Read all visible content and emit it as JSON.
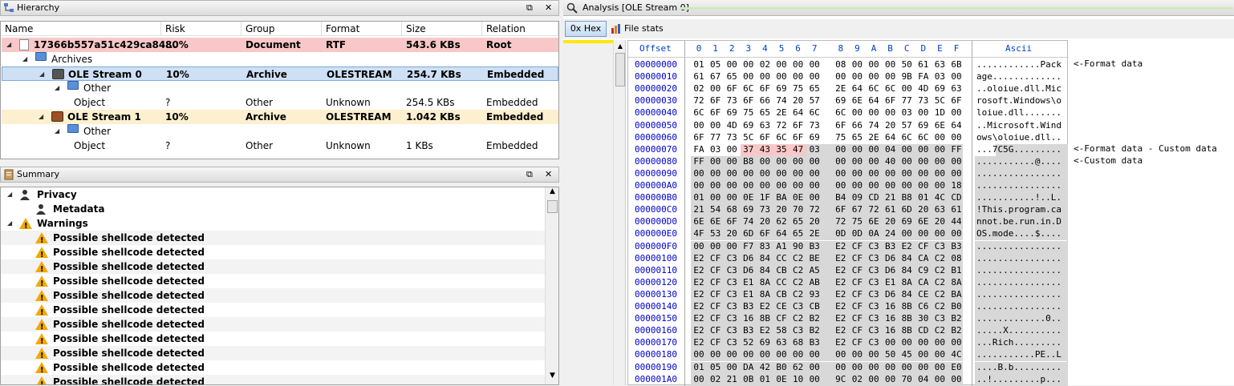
{
  "hierarchy": {
    "title": "Hierarchy",
    "columns": [
      "Name",
      "Risk",
      "Group",
      "Format",
      "Size",
      "Relation"
    ],
    "rows": [
      {
        "name": "17366b557a51c429ca84...",
        "risk": "80%",
        "group": "Document",
        "format": "RTF",
        "size": "543.6 KBs",
        "relation": "Root"
      },
      {
        "name": "Archives"
      },
      {
        "name": "OLE Stream 0",
        "risk": "10%",
        "group": "Archive",
        "format": "OLESTREAM",
        "size": "254.7 KBs",
        "relation": "Embedded"
      },
      {
        "name": "Other"
      },
      {
        "name": "Object",
        "risk": "?",
        "group": "Other",
        "format": "Unknown",
        "size": "254.5 KBs",
        "relation": "Embedded"
      },
      {
        "name": "OLE Stream 1",
        "risk": "10%",
        "group": "Archive",
        "format": "OLESTREAM",
        "size": "1.042 KBs",
        "relation": "Embedded"
      },
      {
        "name": "Other"
      },
      {
        "name": "Object",
        "risk": "?",
        "group": "Other",
        "format": "Unknown",
        "size": "1 KBs",
        "relation": "Embedded"
      }
    ]
  },
  "summary": {
    "title": "Summary",
    "privacy": "Privacy",
    "metadata": "Metadata",
    "warnings": "Warnings",
    "items": [
      "Possible shellcode detected",
      "Possible shellcode detected",
      "Possible shellcode detected",
      "Possible shellcode detected",
      "Possible shellcode detected",
      "Possible shellcode detected",
      "Possible shellcode detected",
      "Possible shellcode detected",
      "Possible shellcode detected",
      "Possible shellcode detected",
      "Possible shellcode detected"
    ]
  },
  "analysis": {
    "title": "Analysis [OLE Stream 0]",
    "hex_button": "0x Hex",
    "stats_button": "File stats",
    "offset_header": "Offset",
    "ascii_header": "Ascii",
    "byte_headers": [
      "0",
      "1",
      "2",
      "3",
      "4",
      "5",
      "6",
      "7",
      "8",
      "9",
      "A",
      "B",
      "C",
      "D",
      "E",
      "F"
    ],
    "rows": [
      {
        "off": "00000000",
        "bytes": "01 05 00 00 02 00 00 00 08 00 00 00 50 61 63 6B",
        "ascii": "............Pack",
        "note": "<-Format data"
      },
      {
        "off": "00000010",
        "bytes": "61 67 65 00 00 00 00 00 00 00 00 00 9B FA 03 00",
        "ascii": "age.............",
        "note": ""
      },
      {
        "off": "00000020",
        "bytes": "02 00 6F 6C 6F 69 75 65 2E 64 6C 6C 00 4D 69 63",
        "ascii": "..oloiue.dll.Mic",
        "note": ""
      },
      {
        "off": "00000030",
        "bytes": "72 6F 73 6F 66 74 20 57 69 6E 64 6F 77 73 5C 6F",
        "ascii": "rosoft.Windows\\o",
        "note": ""
      },
      {
        "off": "00000040",
        "bytes": "6C 6F 69 75 65 2E 64 6C 6C 00 00 00 03 00 1D 00",
        "ascii": "loiue.dll.......",
        "note": ""
      },
      {
        "off": "00000050",
        "bytes": "00 00 4D 69 63 72 6F 73 6F 66 74 20 57 69 6E 64",
        "ascii": "..Microsoft.Wind",
        "note": ""
      },
      {
        "off": "00000060",
        "bytes": "6F 77 73 5C 6F 6C 6F 69 75 65 2E 64 6C 6C 00 00",
        "ascii": "ows\\oloiue.dll..",
        "note": ""
      },
      {
        "off": "00000070",
        "bytes": "FA 03 00 37 43 35 47 03 00 00 00 04 00 00 00 FF",
        "ascii": "...7C5G.........",
        "note": "<-Format data - Custom data"
      },
      {
        "off": "00000080",
        "bytes": "FF 00 00 B8 00 00 00 00 00 00 00 40 00 00 00 00",
        "ascii": "...........@....",
        "note": "<-Custom data"
      },
      {
        "off": "00000090",
        "bytes": "00 00 00 00 00 00 00 00 00 00 00 00 00 00 00 00",
        "ascii": "................",
        "note": ""
      },
      {
        "off": "000000A0",
        "bytes": "00 00 00 00 00 00 00 00 00 00 00 00 00 00 00 18",
        "ascii": "................",
        "note": ""
      },
      {
        "off": "000000B0",
        "bytes": "01 00 00 0E 1F BA 0E 00 B4 09 CD 21 B8 01 4C CD",
        "ascii": "...........!..L.",
        "note": ""
      },
      {
        "off": "000000C0",
        "bytes": "21 54 68 69 73 20 70 72 6F 67 72 61 6D 20 63 61",
        "ascii": "!This.program.ca",
        "note": ""
      },
      {
        "off": "000000D0",
        "bytes": "6E 6E 6F 74 20 62 65 20 72 75 6E 20 69 6E 20 44",
        "ascii": "nnot.be.run.in.D",
        "note": ""
      },
      {
        "off": "000000E0",
        "bytes": "4F 53 20 6D 6F 64 65 2E 0D 0D 0A 24 00 00 00 00",
        "ascii": "OS.mode....$....",
        "note": ""
      },
      {
        "off": "000000F0",
        "bytes": "00 00 00 F7 83 A1 90 B3 E2 CF C3 B3 E2 CF C3 B3",
        "ascii": "................",
        "note": ""
      },
      {
        "off": "00000100",
        "bytes": "E2 CF C3 D6 84 CC C2 BE E2 CF C3 D6 84 CA C2 08",
        "ascii": "................",
        "note": ""
      },
      {
        "off": "00000110",
        "bytes": "E2 CF C3 D6 84 CB C2 A5 E2 CF C3 D6 84 C9 C2 B1",
        "ascii": "................",
        "note": ""
      },
      {
        "off": "00000120",
        "bytes": "E2 CF C3 E1 8A CC C2 AB E2 CF C3 E1 8A CA C2 8A",
        "ascii": "................",
        "note": ""
      },
      {
        "off": "00000130",
        "bytes": "E2 CF C3 E1 8A CB C2 93 E2 CF C3 D6 84 CE C2 BA",
        "ascii": "................",
        "note": ""
      },
      {
        "off": "00000140",
        "bytes": "E2 CF C3 B3 E2 CE C3 CB E2 CF C3 16 8B C6 C2 B0",
        "ascii": "................",
        "note": ""
      },
      {
        "off": "00000150",
        "bytes": "E2 CF C3 16 8B CF C2 B2 E2 CF C3 16 8B 30 C3 B2",
        "ascii": ".............0..",
        "note": ""
      },
      {
        "off": "00000160",
        "bytes": "E2 CF C3 B3 E2 58 C3 B2 E2 CF C3 16 8B CD C2 B2",
        "ascii": ".....X..........",
        "note": ""
      },
      {
        "off": "00000170",
        "bytes": "E2 CF C3 52 69 63 68 B3 E2 CF C3 00 00 00 00 00",
        "ascii": "...Rich.........",
        "note": ""
      },
      {
        "off": "00000180",
        "bytes": "00 00 00 00 00 00 00 00 00 00 00 50 45 00 00 4C",
        "ascii": "...........PE..L",
        "note": ""
      },
      {
        "off": "00000190",
        "bytes": "01 05 00 DA 42 B0 62 00 00 00 00 00 00 00 00 E0",
        "ascii": "....B.b.........",
        "note": ""
      },
      {
        "off": "000001A0",
        "bytes": "00 02 21 0B 01 0E 10 00 9C 02 00 00 70 04 00 00",
        "ascii": "..!.........p...",
        "note": ""
      }
    ]
  }
}
